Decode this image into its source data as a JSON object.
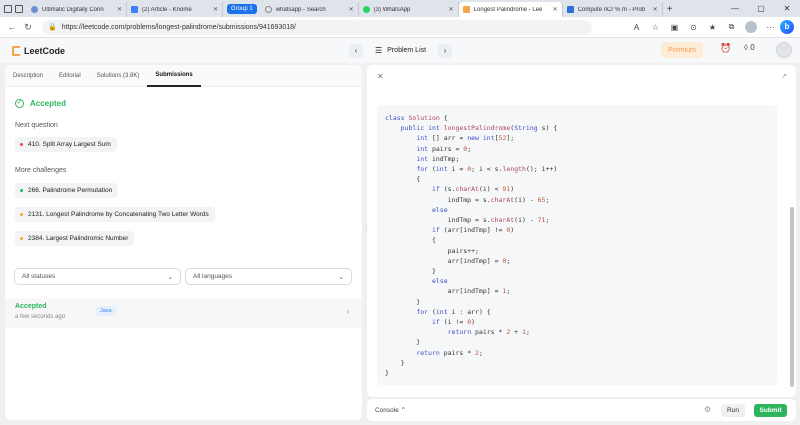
{
  "browser": {
    "tabs": [
      {
        "title": "Ultimatic Digitally Conn",
        "color": "#6b8fd6",
        "active": false
      },
      {
        "title": "(2) Article - Knome",
        "color": "#3b82f6",
        "active": false
      },
      {
        "title": "whatsapp - Search",
        "color": "#888888",
        "active": false
      },
      {
        "title": "(3) WhatsApp",
        "color": "#25d366",
        "active": false
      },
      {
        "title": "Longest Palindrome - Lee",
        "color": "#f0a64a",
        "active": true
      },
      {
        "title": "Compute nCr % m - Prob",
        "color": "#2f6fd6",
        "active": false
      }
    ],
    "group_label": "Group 1",
    "url": "https://leetcode.com/problems/longest-palindrome/submissions/941693018/"
  },
  "header": {
    "logo": "LeetCode",
    "problem_list": "Problem List",
    "premium": "Premium",
    "streak": "0"
  },
  "left": {
    "tabs": [
      "Description",
      "Editorial",
      "Solutions (3.8K)",
      "Submissions"
    ],
    "status": "Accepted",
    "next_question_label": "Next question",
    "next_question": "410. Split Array Largest Sum",
    "more_challenges_label": "More challenges",
    "challenges": [
      "266. Palindrome Permutation",
      "2131. Longest Palindrome by Concatenating Two Letter Words",
      "2384. Largest Palindromic Number"
    ],
    "filter_status": "All statuses",
    "filter_language": "All languages",
    "submission": {
      "status": "Accepted",
      "time": "a few seconds ago",
      "language": "Java"
    }
  },
  "right": {
    "console_label": "Console",
    "run_label": "Run",
    "submit_label": "Submit"
  }
}
